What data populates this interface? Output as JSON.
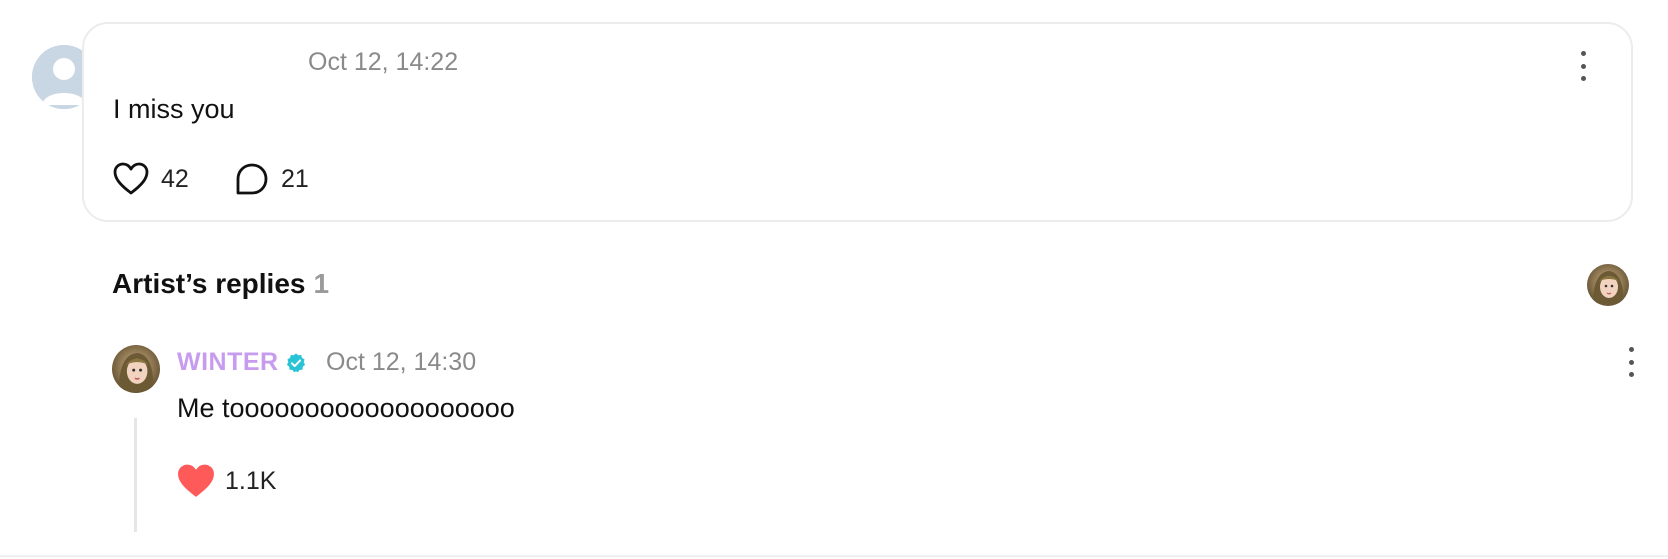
{
  "post": {
    "author_avatar": "default-user-avatar",
    "timestamp": "Oct 12, 14:22",
    "text": "I miss you",
    "like_count": "42",
    "comment_count": "21",
    "like_icon": "heart-outline-icon",
    "comment_icon": "comment-bubble-icon",
    "more_icon": "more-vertical-icon"
  },
  "artist_replies": {
    "title": "Artist’s replies",
    "count": "1",
    "avatar": "artist-avatar"
  },
  "reply": {
    "author": "WINTER",
    "verified_icon": "verified-badge-icon",
    "timestamp": "Oct 12, 14:30",
    "text": "Me tooooooooooooooooooo",
    "like_count": "1.1K",
    "like_icon": "heart-filled-icon",
    "more_icon": "more-vertical-icon"
  },
  "colors": {
    "artist_name": "#c79cef",
    "verified_badge": "#27c3d6",
    "liked_heart": "#ff5a5a",
    "timestamp": "#8a8a8a",
    "reply_count": "#9a9a9a",
    "card_border": "#ececec"
  }
}
